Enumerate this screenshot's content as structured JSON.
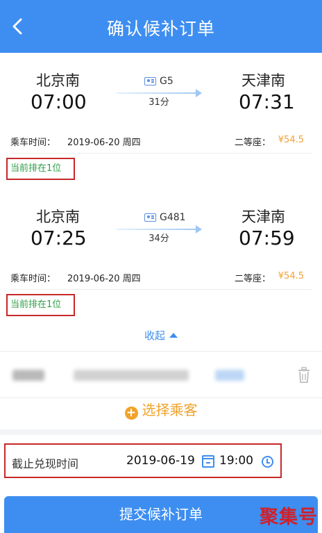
{
  "header": {
    "title": "确认候补订单",
    "back_icon": "chevron-left-icon"
  },
  "trains": [
    {
      "departure_station": "北京南",
      "departure_time": "07:00",
      "train_no": "G5",
      "duration": "31分",
      "arrival_station": "天津南",
      "arrival_time": "07:31",
      "date_label": "乘车时间：",
      "date_value": "2019-06-20 周四",
      "seat_type": "二等座：",
      "price": "¥54.5",
      "queue_status": "当前排在1位"
    },
    {
      "departure_station": "北京南",
      "departure_time": "07:25",
      "train_no": "G481",
      "duration": "34分",
      "arrival_station": "天津南",
      "arrival_time": "07:59",
      "date_label": "乘车时间：",
      "date_value": "2019-06-20 周四",
      "seat_type": "二等座：",
      "price": "¥54.5",
      "queue_status": "当前排在1位"
    }
  ],
  "collapse_label": "收起",
  "add_passenger_label": "选择乘客",
  "deadline": {
    "label": "截止兑现时间",
    "date": "2019-06-19",
    "time": "19:00"
  },
  "submit_label": "提交候补订单",
  "watermark": "聚集号",
  "colors": {
    "primary": "#3d8ef0",
    "price": "#f3a035",
    "queue_text": "#2e9e48",
    "highlight_border": "#c62828",
    "add_passenger": "#f0a22a",
    "watermark": "#d0202a"
  }
}
